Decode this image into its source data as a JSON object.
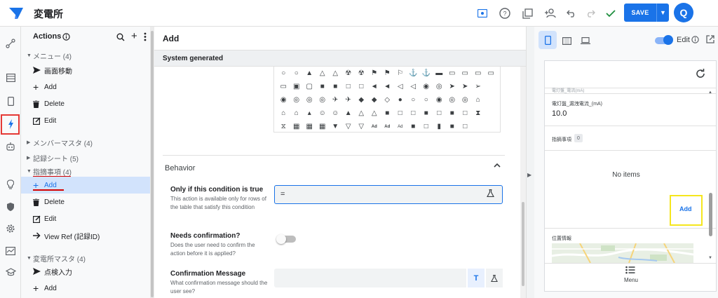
{
  "topbar": {
    "app_title": "変電所",
    "save_label": "SAVE",
    "avatar_initial": "Q"
  },
  "actions_panel": {
    "header": "Actions",
    "groups": [
      {
        "label": "メニュー (4)",
        "items": [
          "画面移動",
          "Add",
          "Delete",
          "Edit"
        ]
      },
      {
        "label": "メンバーマスタ (4)"
      },
      {
        "label": "記録シート (5)"
      },
      {
        "label": "指摘事項 (4)",
        "items": [
          "Add",
          "Delete",
          "Edit",
          "View Ref (記録ID)"
        ]
      },
      {
        "label": "変電所マスタ (4)",
        "items": [
          "点検入力",
          "Add"
        ]
      }
    ]
  },
  "editor": {
    "title": "Add",
    "system_generated": "System generated",
    "behavior": "Behavior",
    "condition": {
      "title": "Only if this condition is true",
      "desc": "This action is available only for rows of the table that satisfy this condition",
      "value": "="
    },
    "needs_confirmation": {
      "title": "Needs confirmation?",
      "desc": "Does the user need to confirm the action before it is applied?"
    },
    "confirmation_message": {
      "title": "Confirmation Message",
      "desc": "What confirmation message should the user see?",
      "t_label": "T"
    }
  },
  "preview": {
    "edit_label": "Edit",
    "cut_label": "電灯盤_電流(mA)",
    "field_label": "電灯盤_漏洩電流_(mA)",
    "field_value": "10.0",
    "instr_label": "指摘事項",
    "instr_count": "0",
    "no_items": "No items",
    "add_label": "Add",
    "location_label": "位置情報",
    "menu_label": "Menu"
  },
  "colors": {
    "brand": "#1a73e8",
    "highlight_red": "#e53935",
    "highlight_yellow": "#f5e61e"
  }
}
